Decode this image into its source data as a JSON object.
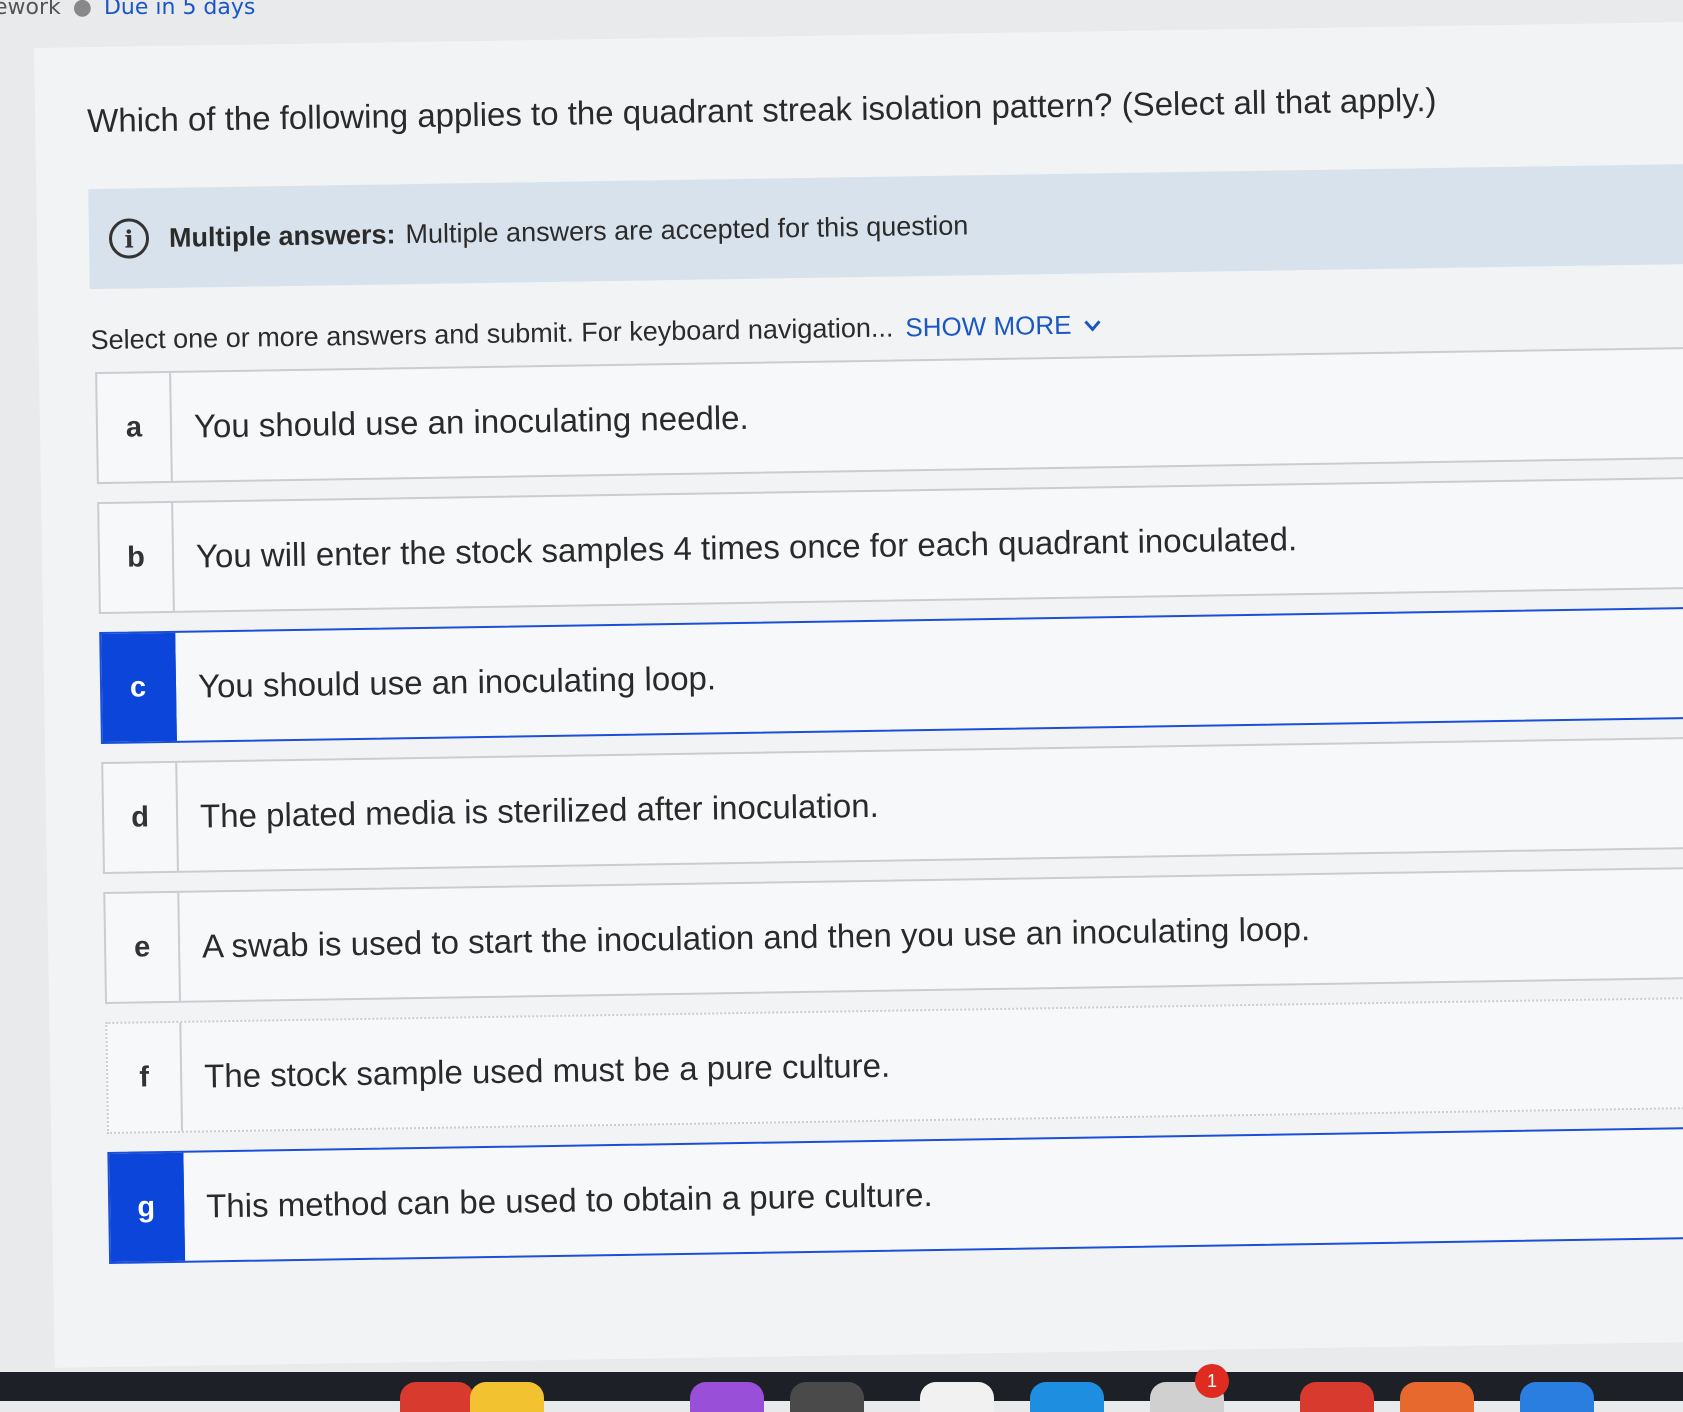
{
  "topbar": {
    "context": "ework",
    "due": "Due in 5 days"
  },
  "question": {
    "text": "Which of the following applies to the quadrant streak isolation pattern? (Select all that apply.)"
  },
  "banner": {
    "label": "Multiple answers:",
    "text": "Multiple answers are accepted for this question"
  },
  "instructions": {
    "text": "Select one or more answers and submit. For keyboard navigation...",
    "show_more": "SHOW MORE"
  },
  "options": [
    {
      "letter": "a",
      "text": "You should use an inoculating needle.",
      "selected": false
    },
    {
      "letter": "b",
      "text": "You will enter the stock samples 4 times once for each quadrant inoculated.",
      "selected": false
    },
    {
      "letter": "c",
      "text": "You should use an inoculating loop.",
      "selected": true
    },
    {
      "letter": "d",
      "text": "The plated media is sterilized after inoculation.",
      "selected": false
    },
    {
      "letter": "e",
      "text": "A swab is used to start the inoculation and then you use an inoculating loop.",
      "selected": false
    },
    {
      "letter": "f",
      "text": "The stock sample used must be a pure culture.",
      "selected": false
    },
    {
      "letter": "g",
      "text": "This method can be used to obtain a pure culture.",
      "selected": true
    }
  ],
  "taskbar": {
    "notification_count": "1"
  },
  "colors": {
    "accent": "#0b45d9",
    "link": "#1a56c4",
    "banner_bg": "#d8e2ec"
  },
  "icons": {
    "info": "info-circle-icon",
    "show_more": "chevron-down-icon"
  }
}
